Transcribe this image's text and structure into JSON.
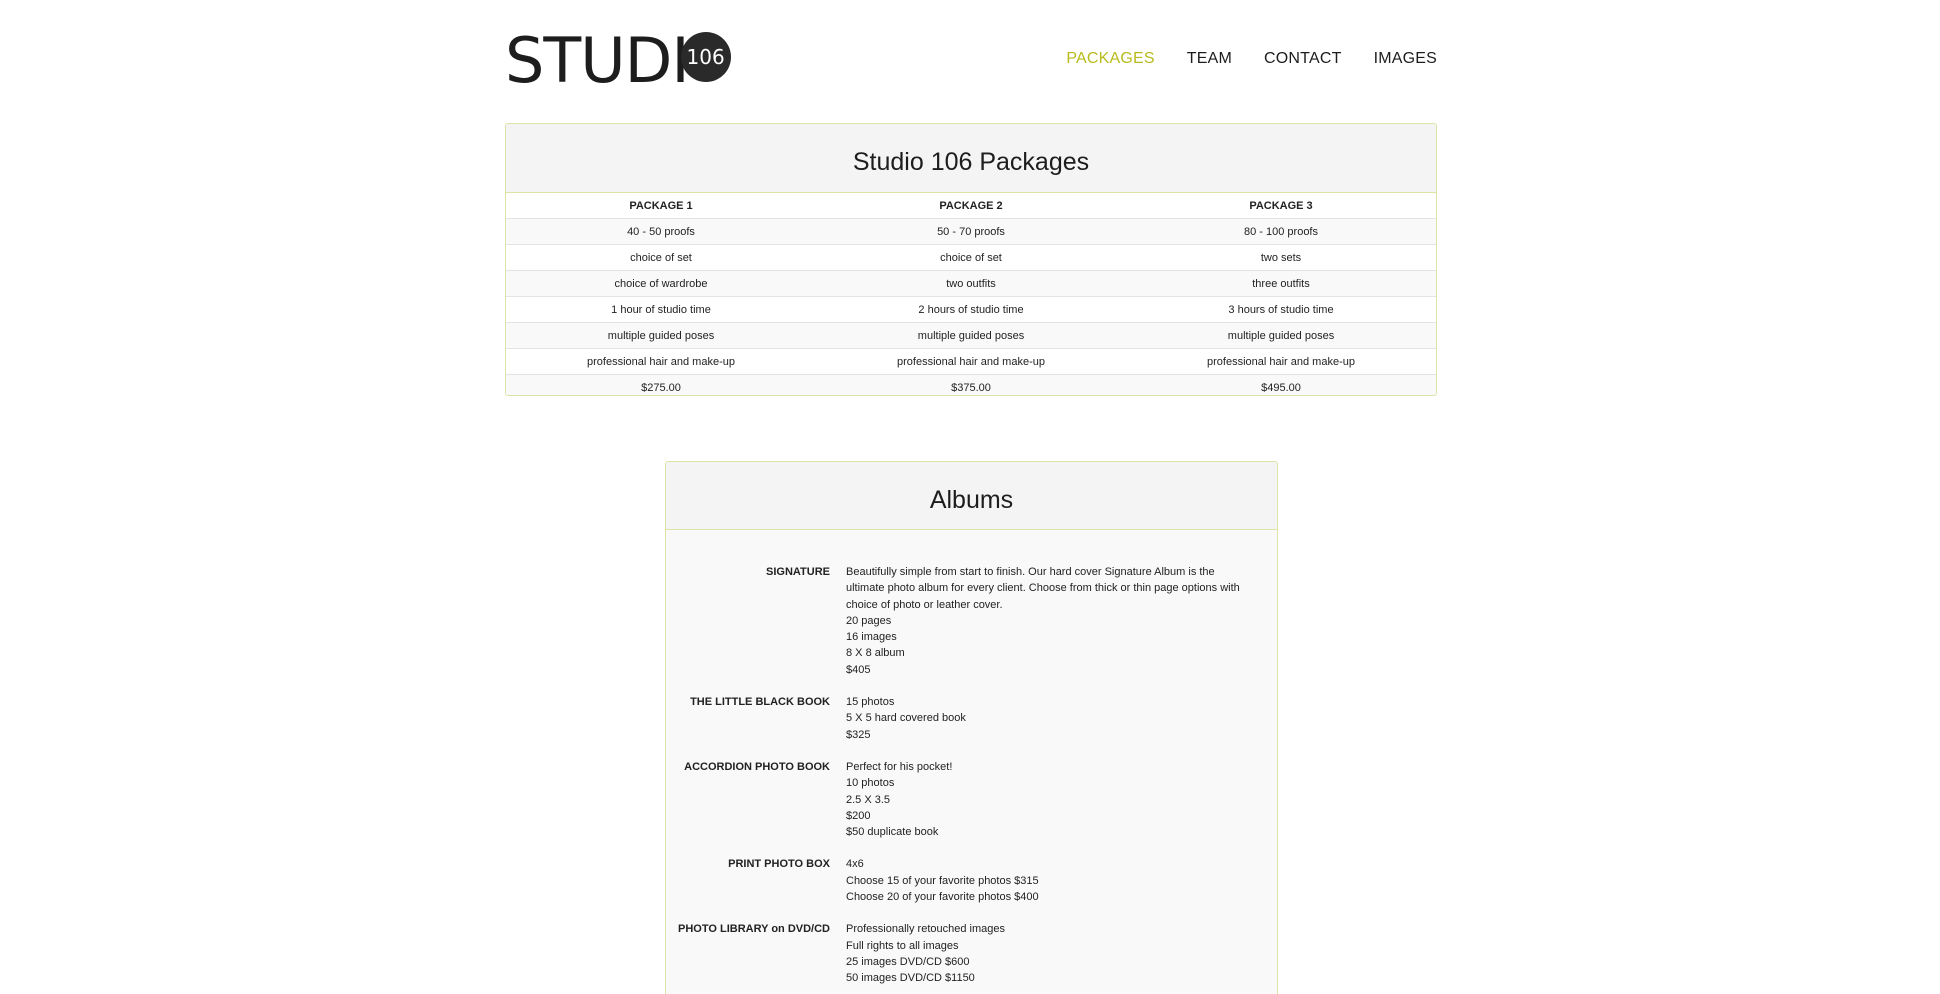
{
  "logo": {
    "word": "STUDI",
    "badge": "106"
  },
  "nav": {
    "items": [
      {
        "label": "PACKAGES",
        "active": true
      },
      {
        "label": "TEAM",
        "active": false
      },
      {
        "label": "CONTACT",
        "active": false
      },
      {
        "label": "IMAGES",
        "active": false
      }
    ]
  },
  "packages": {
    "title": "Studio 106 Packages",
    "headers": [
      "PACKAGE 1",
      "PACKAGE 2",
      "PACKAGE 3"
    ],
    "rows": [
      [
        "40 - 50 proofs",
        "50 - 70 proofs",
        "80 - 100 proofs"
      ],
      [
        "choice of set",
        "choice of set",
        "two sets"
      ],
      [
        "choice of wardrobe",
        "two outfits",
        "three outfits"
      ],
      [
        "1 hour of studio time",
        "2 hours of studio time",
        "3 hours of studio time"
      ],
      [
        "multiple guided poses",
        "multiple guided poses",
        "multiple guided poses"
      ],
      [
        "professional hair and make-up",
        "professional hair and make-up",
        "professional hair and make-up"
      ],
      [
        "$275.00",
        "$375.00",
        "$495.00"
      ]
    ]
  },
  "albums": {
    "title": "Albums",
    "items": [
      {
        "name": "SIGNATURE",
        "lines": [
          "Beautifully simple from start to finish. Our hard cover Signature Album is the ultimate photo album for every client. Choose from thick or thin page options with choice of photo or leather cover.",
          "20 pages",
          "16 images",
          "8 X 8 album",
          "$405"
        ]
      },
      {
        "name": "THE LITTLE BLACK BOOK",
        "lines": [
          "15 photos",
          "5 X 5 hard covered book",
          "$325"
        ]
      },
      {
        "name": "ACCORDION PHOTO BOOK",
        "lines": [
          "Perfect for his pocket!",
          "10 photos",
          "2.5 X 3.5",
          "$200",
          "$50 duplicate book"
        ]
      },
      {
        "name": "PRINT PHOTO BOX",
        "lines": [
          "4x6",
          "Choose 15 of your favorite photos $315",
          "Choose 20 of your favorite photos $400"
        ]
      },
      {
        "name": "PHOTO LIBRARY on DVD/CD",
        "lines": [
          "Professionally retouched images",
          "Full rights to all images",
          "25 images DVD/CD $600",
          "50 images DVD/CD $1150"
        ]
      }
    ]
  }
}
